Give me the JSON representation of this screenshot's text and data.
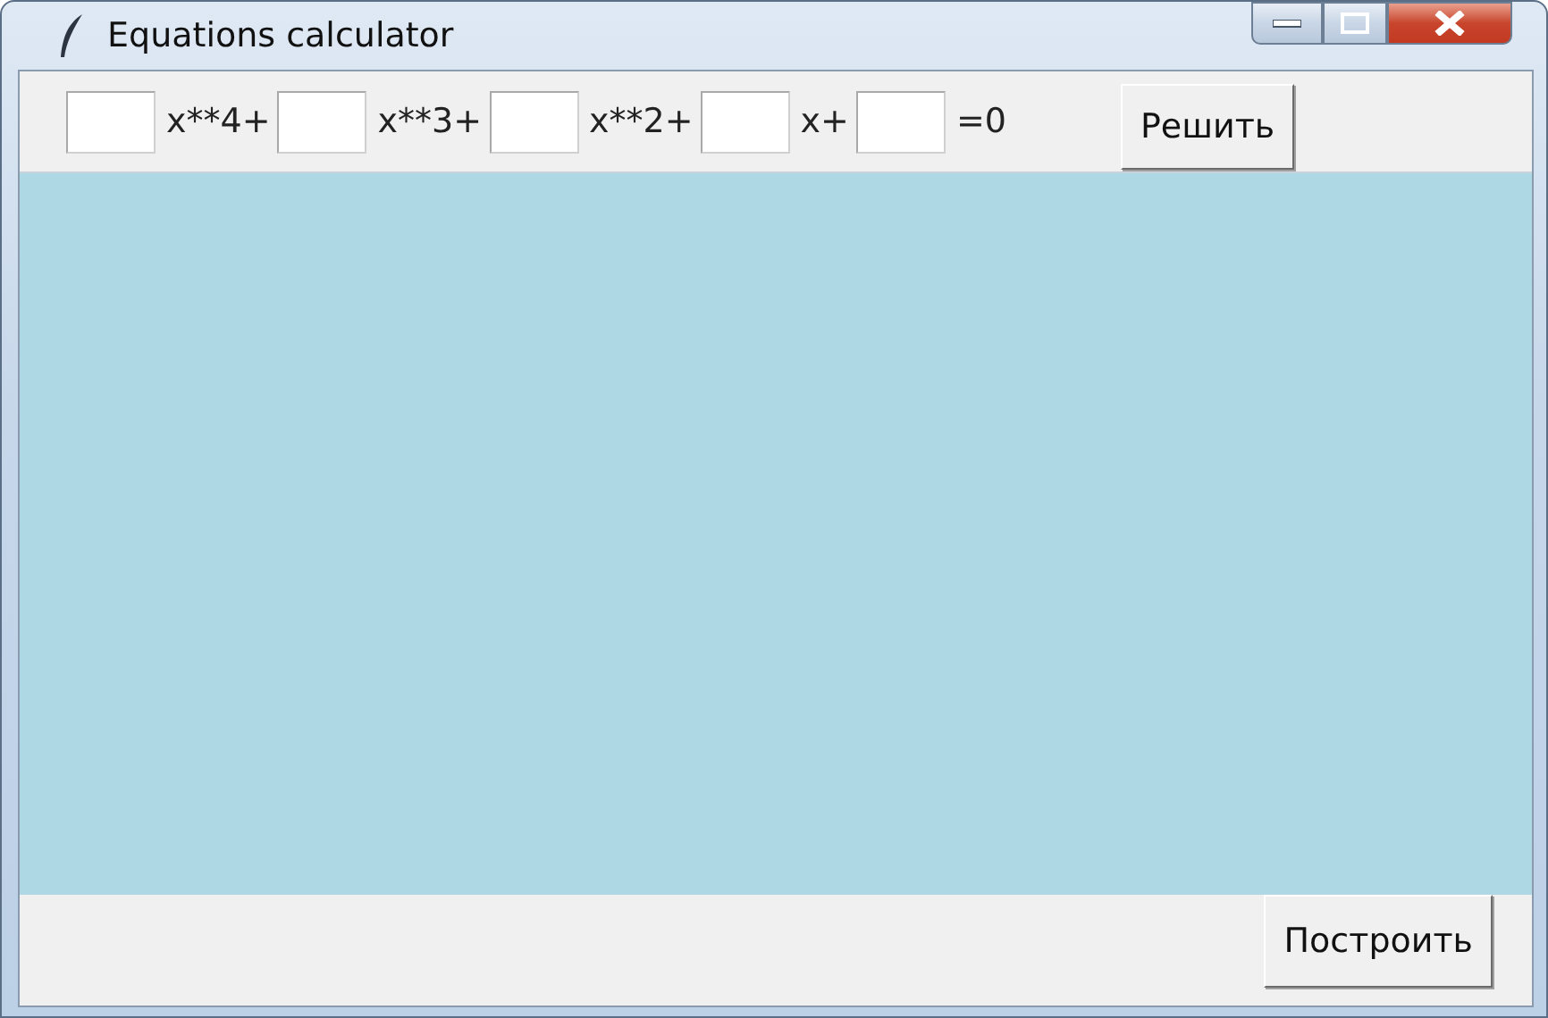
{
  "window": {
    "title": "Equations calculator"
  },
  "equation": {
    "terms": [
      {
        "suffix": "x**4+"
      },
      {
        "suffix": "x**3+"
      },
      {
        "suffix": "x**2+"
      },
      {
        "suffix": "x+"
      },
      {
        "suffix": "=0"
      }
    ],
    "solve_button": "Решить"
  },
  "plot_button": "Построить"
}
